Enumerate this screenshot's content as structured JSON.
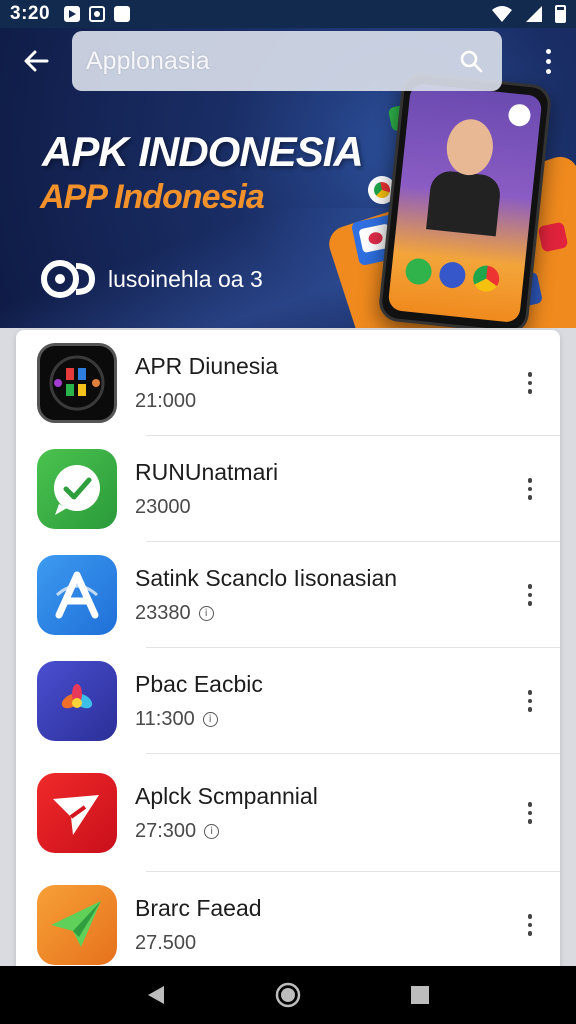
{
  "status_bar": {
    "time": "3:20"
  },
  "search": {
    "query": "Applonasia"
  },
  "banner": {
    "title": "APK INDONESIA",
    "subtitle": "APP Indonesia",
    "brand_text": "lusoinehla oa  3"
  },
  "apps": [
    {
      "name": "APR Diunesia",
      "count": "21:000",
      "has_info": false,
      "icon": "dark-dial-icon"
    },
    {
      "name": "RUNUnatmari",
      "count": "23000",
      "has_info": false,
      "icon": "green-chat-icon"
    },
    {
      "name": "Satink Scanclo Iisonasian",
      "count": "23380",
      "has_info": true,
      "icon": "blue-a-icon"
    },
    {
      "name": "Pbac Eacbic",
      "count": "11:300",
      "has_info": true,
      "icon": "indigo-flower-icon"
    },
    {
      "name": "Aplck Scmpannial",
      "count": "27:300",
      "has_info": true,
      "icon": "red-plane-icon"
    },
    {
      "name": "Brarc Faead",
      "count": "27.500",
      "has_info": false,
      "icon": "orange-paper-plane-icon"
    }
  ],
  "colors": {
    "hero_bg": "#1a2e66",
    "accent_orange": "#f3912a",
    "status_bar": "#122a4e"
  }
}
